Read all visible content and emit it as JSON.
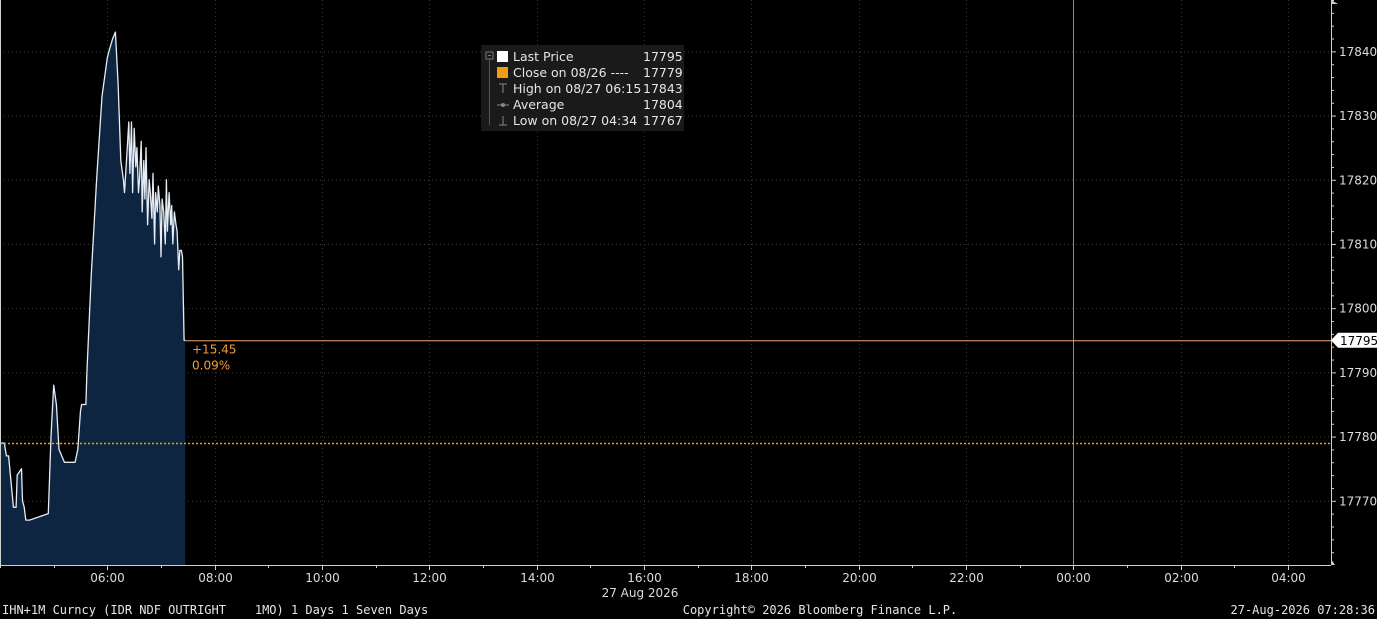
{
  "footer": {
    "security": "IHN+1M Curncy (IDR NDF OUTRIGHT    1MO) 1 Days 1 Seven Days",
    "copyright": "Copyright© 2026 Bloomberg Finance L.P.",
    "timestamp": "27-Aug-2026 07:28:36"
  },
  "legend": {
    "rows": [
      {
        "label": "Last Price",
        "value": "17795",
        "icon": "square-white"
      },
      {
        "label": "Close on 08/26 ----",
        "value": "17779",
        "icon": "square-orange"
      },
      {
        "label": "High on 08/27 06:15",
        "value": "17843",
        "icon": "high-marker-icon"
      },
      {
        "label": "Average",
        "value": "17804",
        "icon": "average-marker-icon"
      },
      {
        "label": "Low on 08/27 04:34",
        "value": "17767",
        "icon": "low-marker-icon"
      }
    ]
  },
  "change_annotation": {
    "abs": "+15.45",
    "pct": "0.09%"
  },
  "last_price_tag": "17795",
  "colors": {
    "background": "#000000",
    "area_fill": "#0d2540",
    "price_line": "#e6edf5",
    "last_line": "#f5a56b",
    "close_line": "#f39c12",
    "grid": "#3a3a3a",
    "axis_text": "#dcdcdc",
    "annotation": "#f39c3a"
  },
  "chart_data": {
    "type": "area",
    "title": "",
    "xlabel": "27 Aug 2026",
    "ylabel": "",
    "x_tick_labels": [
      "06:00",
      "08:00",
      "10:00",
      "12:00",
      "14:00",
      "16:00",
      "18:00",
      "20:00",
      "22:00",
      "00:00",
      "02:00",
      "04:00"
    ],
    "x_tick_hours": [
      6,
      8,
      10,
      12,
      14,
      16,
      18,
      20,
      22,
      24,
      26,
      28
    ],
    "xlim_hours": [
      4.0,
      28.8
    ],
    "y_ticks": [
      17770,
      17780,
      17790,
      17800,
      17810,
      17820,
      17830,
      17840
    ],
    "ylim": [
      17760,
      17848
    ],
    "grid": true,
    "legend_position": "top-center",
    "series": [
      {
        "name": "Last Price",
        "x": [
          4.0,
          4.08,
          4.12,
          4.16,
          4.25,
          4.3,
          4.32,
          4.4,
          4.42,
          4.45,
          4.48,
          4.5,
          4.52,
          4.55,
          4.9,
          4.95,
          5.0,
          5.05,
          5.1,
          5.2,
          5.22,
          5.3,
          5.35,
          5.4,
          5.45,
          5.5,
          5.52,
          5.6,
          5.62,
          5.7,
          5.8,
          5.9,
          6.0,
          6.03,
          6.1,
          6.15,
          6.2,
          6.25,
          6.3,
          6.32,
          6.35,
          6.4,
          6.42,
          6.45,
          6.47,
          6.5,
          6.53,
          6.55,
          6.58,
          6.6,
          6.63,
          6.65,
          6.68,
          6.7,
          6.72,
          6.75,
          6.78,
          6.8,
          6.83,
          6.85,
          6.88,
          6.9,
          6.93,
          6.95,
          6.98,
          7.0,
          7.02,
          7.05,
          7.08,
          7.1,
          7.12,
          7.15,
          7.18,
          7.2,
          7.22,
          7.25,
          7.28,
          7.3,
          7.33,
          7.35,
          7.38,
          7.4,
          7.43,
          7.45
        ],
        "y": [
          17779,
          17779,
          17777,
          17777,
          17769,
          17769,
          17774,
          17775,
          17770,
          17769,
          17767,
          17767,
          17767,
          17767,
          17768,
          17780,
          17788,
          17785,
          17778,
          17776,
          17776,
          17776,
          17776,
          17776,
          17778,
          17784,
          17785,
          17785,
          17790,
          17805,
          17820,
          17833,
          17839,
          17840,
          17842,
          17843,
          17835,
          17823,
          17820,
          17818,
          17822,
          17829,
          17821,
          17829,
          17818,
          17828,
          17822,
          17825,
          17818,
          17820,
          17826,
          17815,
          17823,
          17817,
          17825,
          17813,
          17820,
          17818,
          17814,
          17821,
          17810,
          17818,
          17815,
          17819,
          17816,
          17808,
          17817,
          17815,
          17810,
          17820,
          17812,
          17818,
          17813,
          17816,
          17810,
          17815,
          17813,
          17812,
          17806,
          17809,
          17809,
          17808,
          17795,
          17795
        ]
      },
      {
        "name": "Close on 08/26",
        "value": 17779
      }
    ],
    "last_value": 17795
  }
}
